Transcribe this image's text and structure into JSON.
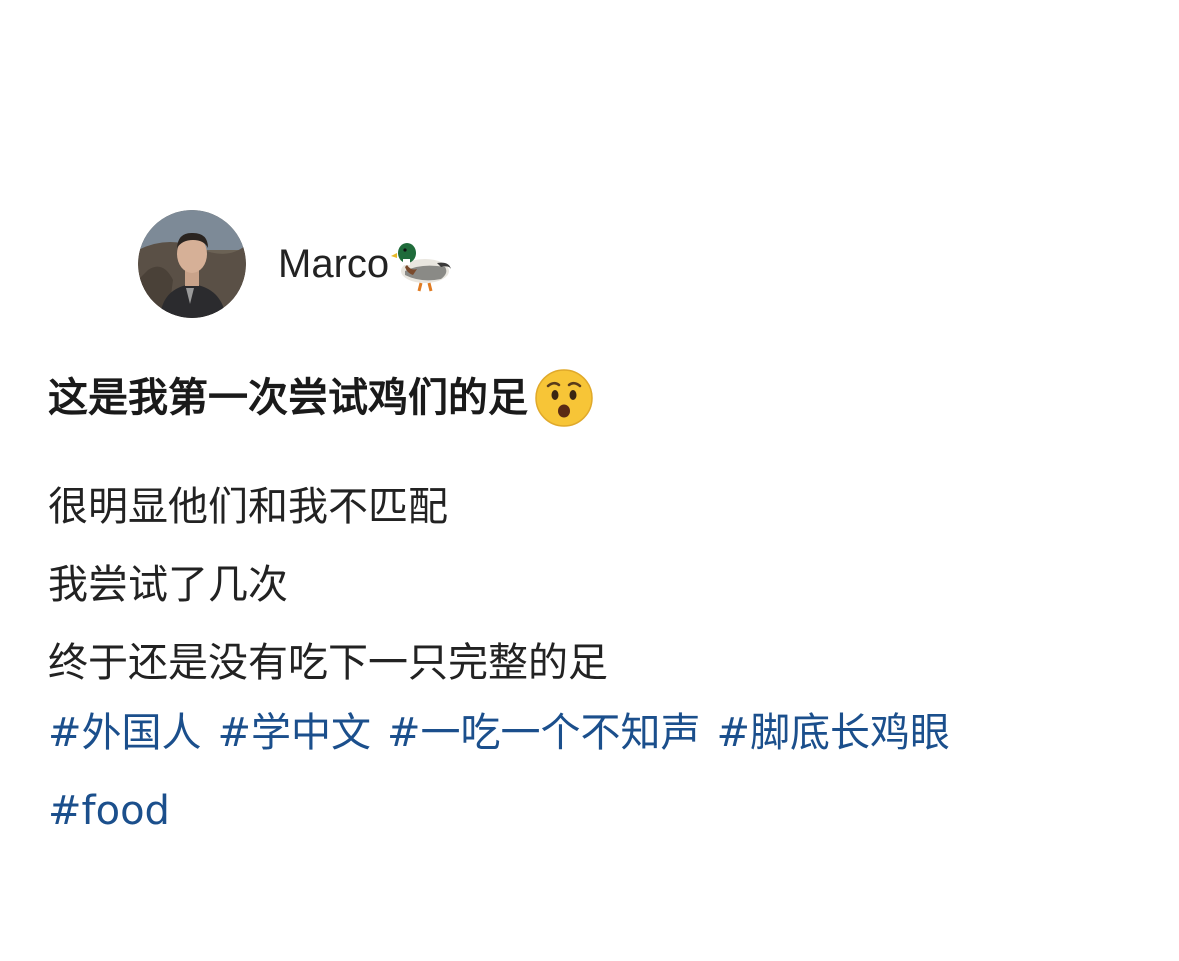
{
  "author": {
    "name": "Marco",
    "avatar_icon": "user-avatar-photo",
    "badge_icon": "duck-icon"
  },
  "post": {
    "title": "这是我第一次尝试鸡们的足",
    "title_emoji": "anxious-face-icon",
    "lines": [
      "很明显他们和我不匹配",
      "我尝试了几次",
      "终于还是没有吃下一只完整的足"
    ],
    "hashtags": [
      "#外国人",
      "#学中文",
      "#一吃一个不知声",
      "#脚底长鸡眼",
      "#food"
    ]
  },
  "colors": {
    "background": "#ffffff",
    "text": "#1f1f1f",
    "hashtag": "#1b4f8c"
  }
}
